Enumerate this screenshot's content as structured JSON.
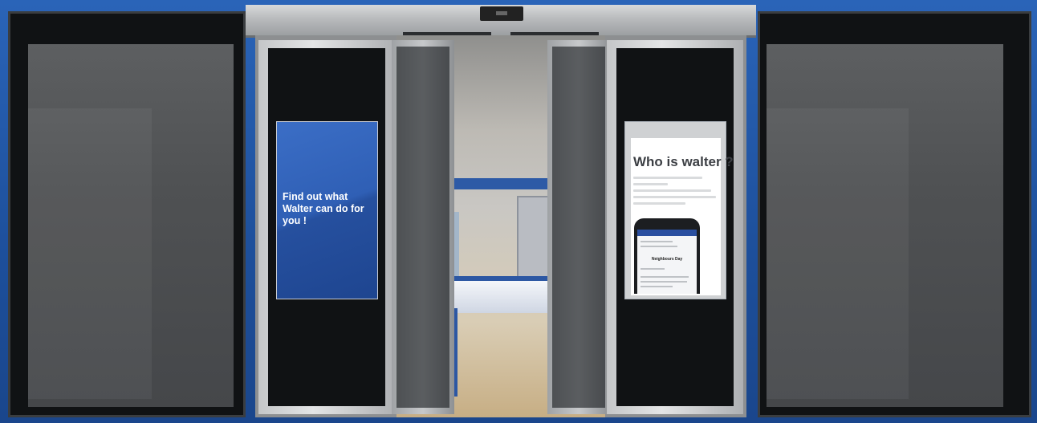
{
  "scene": {
    "poster_left": {
      "headline": "Find out what Walter can do for you !"
    },
    "poster_right": {
      "title": "Who is walter ?",
      "phone_event_title": "Neighbours Day"
    }
  },
  "colors": {
    "brand_blue": "#2f5fb5",
    "background_blue": "#1d4f9b"
  }
}
